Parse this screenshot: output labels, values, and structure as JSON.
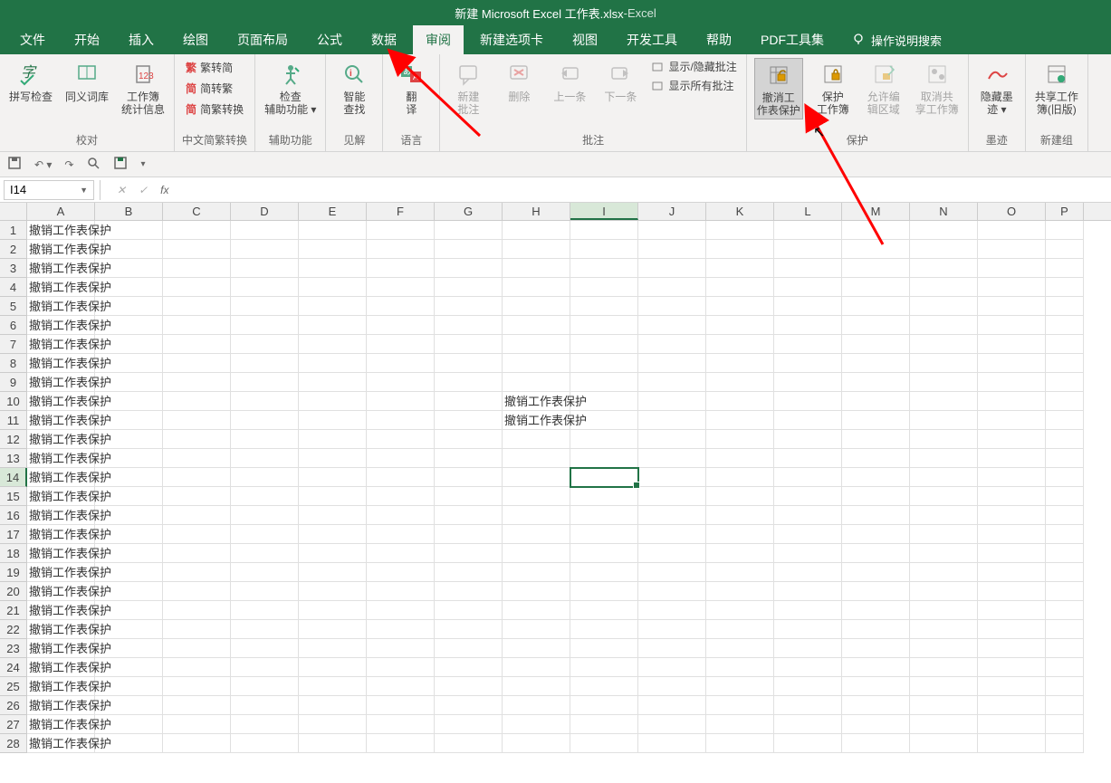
{
  "title": {
    "filename": "新建 Microsoft Excel 工作表.xlsx",
    "app": "Excel",
    "sep": "  -  "
  },
  "tabs": [
    "文件",
    "开始",
    "插入",
    "绘图",
    "页面布局",
    "公式",
    "数据",
    "审阅",
    "新建选项卡",
    "视图",
    "开发工具",
    "帮助",
    "PDF工具集"
  ],
  "active_tab_index": 7,
  "tell_me": "操作说明搜索",
  "ribbon": {
    "groups": [
      {
        "label": "校对",
        "buttons": [
          {
            "key": "spellcheck",
            "label": "拼写检查"
          },
          {
            "key": "thesaurus",
            "label": "同义词库"
          },
          {
            "key": "workbook-stats",
            "label": "工作簿\n统计信息"
          }
        ]
      },
      {
        "label": "中文简繁转换",
        "small": [
          {
            "prefix": "繁",
            "label": "繁转简"
          },
          {
            "prefix": "简",
            "label": "简转繁"
          },
          {
            "prefix": "简",
            "label": "简繁转换"
          }
        ]
      },
      {
        "label": "辅助功能",
        "buttons": [
          {
            "key": "accessibility",
            "label": "检查\n辅助功能 ▾"
          }
        ]
      },
      {
        "label": "见解",
        "buttons": [
          {
            "key": "smart-lookup",
            "label": "智能\n查找"
          }
        ]
      },
      {
        "label": "语言",
        "buttons": [
          {
            "key": "translate",
            "label": "翻\n译"
          }
        ]
      },
      {
        "label": "批注",
        "buttons": [
          {
            "key": "new-comment",
            "label": "新建\n批注",
            "disabled": true
          },
          {
            "key": "delete-comment",
            "label": "删除",
            "disabled": true
          },
          {
            "key": "prev-comment",
            "label": "上一条",
            "disabled": true
          },
          {
            "key": "next-comment",
            "label": "下一条",
            "disabled": true
          }
        ],
        "checks": [
          {
            "label": "显示/隐藏批注"
          },
          {
            "label": "显示所有批注"
          }
        ]
      },
      {
        "label": "保护",
        "buttons": [
          {
            "key": "unprotect-sheet",
            "label": "撤消工\n作表保护",
            "highlight": true
          },
          {
            "key": "protect-workbook",
            "label": "保护\n工作簿"
          },
          {
            "key": "allow-edit-ranges",
            "label": "允许编\n辑区域",
            "disabled": true
          },
          {
            "key": "unshare",
            "label": "取消共\n享工作簿",
            "disabled": true
          }
        ]
      },
      {
        "label": "墨迹",
        "buttons": [
          {
            "key": "hide-ink",
            "label": "隐藏墨\n迹 ▾"
          }
        ]
      },
      {
        "label": "新建组",
        "buttons": [
          {
            "key": "share-workbook-legacy",
            "label": "共享工作\n簿(旧版)"
          }
        ]
      }
    ]
  },
  "cell_ref": "I14",
  "columns": [
    "A",
    "B",
    "C",
    "D",
    "E",
    "F",
    "G",
    "H",
    "I",
    "J",
    "K",
    "L",
    "M",
    "N",
    "O",
    "P"
  ],
  "selected_col_index": 8,
  "selected_row_index": 13,
  "row_count": 28,
  "cells": {
    "A": {
      "rows": [
        1,
        2,
        3,
        4,
        5,
        6,
        7,
        8,
        9,
        10,
        11,
        12,
        13,
        14,
        15,
        16,
        17,
        18,
        19,
        20,
        21,
        22,
        23,
        24,
        25,
        26,
        27,
        28
      ],
      "value": "撤销工作表保护"
    },
    "H": {
      "rows": [
        10,
        11
      ],
      "value": "撤销工作表保护"
    }
  }
}
